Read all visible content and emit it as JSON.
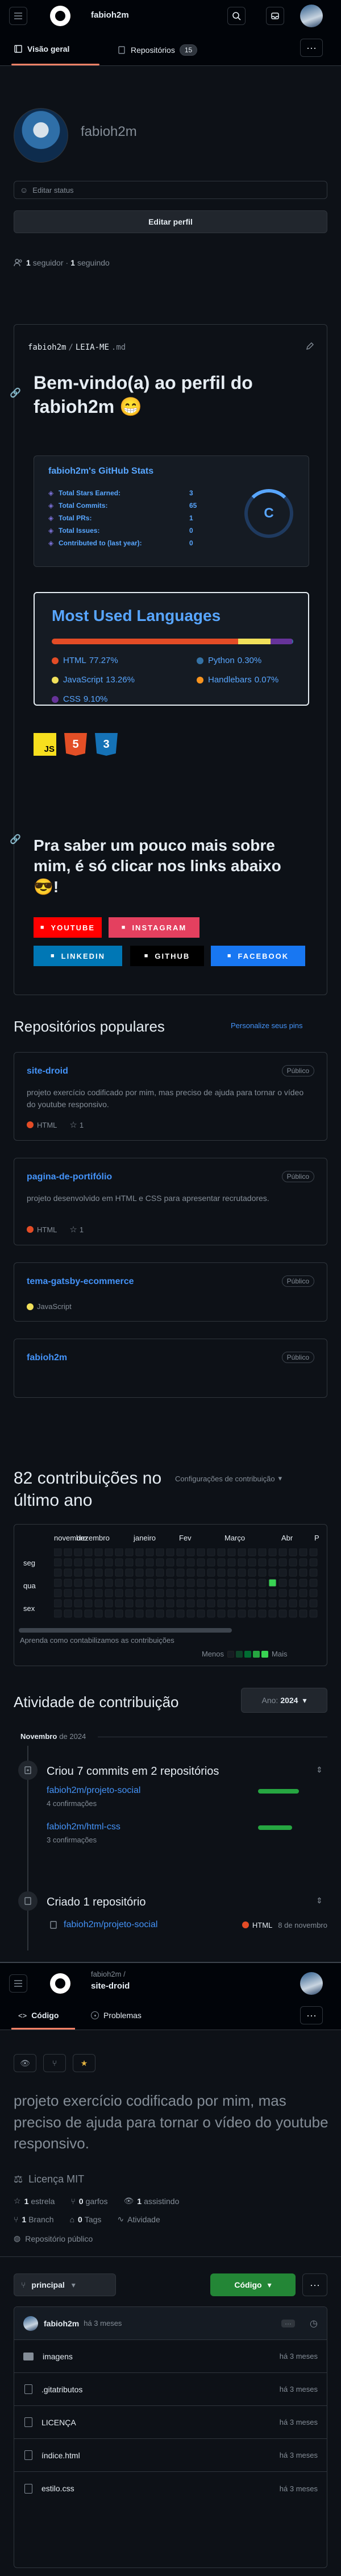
{
  "profile": {
    "header_user": "fabioh2m",
    "tabs": [
      {
        "label": "Visão geral"
      },
      {
        "label": "Repositórios",
        "count": "15"
      }
    ],
    "username": "fabioh2m",
    "status_placeholder": "Editar status",
    "edit_profile": "Editar perfil",
    "followers_count": "1",
    "followers_label": "seguidor",
    "following_count": "1",
    "following_label": "seguindo"
  },
  "readme": {
    "path_user": "fabioh2m",
    "path_sep": "/",
    "path_file": "LEIA-ME",
    "path_ext": ".md",
    "heading": "Bem-vindo(a) ao perfil do fabioh2m 😁",
    "stats": {
      "title": "fabioh2m's GitHub Stats",
      "rows": [
        {
          "label": "Total Stars Earned:",
          "value": "3"
        },
        {
          "label": "Total Commits:",
          "value": "65"
        },
        {
          "label": "Total PRs:",
          "value": "1"
        },
        {
          "label": "Total Issues:",
          "value": "0"
        },
        {
          "label": "Contributed to (last year):",
          "value": "0"
        }
      ],
      "grade": "C"
    },
    "langs": {
      "title": "Most Used Languages",
      "items": [
        {
          "name": "HTML",
          "pct": "77.27%",
          "value": 77.27,
          "color": "#e34c26"
        },
        {
          "name": "Python",
          "pct": "0.30%",
          "value": 0.3,
          "color": "#3572A5"
        },
        {
          "name": "JavaScript",
          "pct": "13.26%",
          "value": 13.26,
          "color": "#f1e05a"
        },
        {
          "name": "Handlebars",
          "pct": "0.07%",
          "value": 0.07,
          "color": "#f7931e"
        },
        {
          "name": "CSS",
          "pct": "9.10%",
          "value": 9.1,
          "color": "#663399"
        }
      ]
    },
    "tech_icons": [
      "JS",
      "5",
      "3"
    ],
    "links_heading": "Pra saber um pouco mais sobre mim, é só clicar nos links abaixo 😎!",
    "social": [
      {
        "label": "YOUTUBE",
        "color": "#ff0000"
      },
      {
        "label": "INSTAGRAM",
        "color": "#e4405f"
      },
      {
        "label": "LINKEDIN",
        "color": "#0077b5"
      },
      {
        "label": "GITHUB",
        "color": "#000000"
      },
      {
        "label": "FACEBOOK",
        "color": "#1877f2"
      }
    ]
  },
  "popular": {
    "title": "Repositórios populares",
    "customize": "Personalize seus pins",
    "repos": [
      {
        "name": "site-droid",
        "visibility": "Público",
        "desc": "projeto exercício codificado por mim, mas preciso de ajuda para tornar o vídeo do youtube responsivo.",
        "lang": "HTML",
        "lang_color": "#e34c26",
        "stars": "1"
      },
      {
        "name": "pagina-de-portifólio",
        "visibility": "Público",
        "desc": "projeto desenvolvido em HTML e CSS para apresentar recrutadores.",
        "lang": "HTML",
        "lang_color": "#e34c26",
        "stars": "1"
      },
      {
        "name": "tema-gatsby-ecommerce",
        "visibility": "Público",
        "desc": "",
        "lang": "JavaScript",
        "lang_color": "#f1e05a",
        "stars": ""
      },
      {
        "name": "fabioh2m",
        "visibility": "Público",
        "desc": "",
        "lang": "",
        "lang_color": "",
        "stars": ""
      }
    ]
  },
  "contrib": {
    "title": "82 contribuições no último ano",
    "settings": "Configurações de contribuição",
    "months": [
      "novembro",
      "dezembro",
      "janeiro",
      "Fev",
      "Março",
      "Abr",
      "P"
    ],
    "days": [
      "seg",
      "qua",
      "sex"
    ],
    "learn": "Aprenda como contabilizamos as contribuições",
    "less": "Menos",
    "more": "Mais"
  },
  "activity": {
    "title": "Atividade de contribuição",
    "year_label": "Ano:",
    "year": "2024",
    "month_name": "Novembro",
    "month_year": "de 2024",
    "commits_title": "Criou 7 commits em 2 repositórios",
    "commit_repos": [
      {
        "name": "fabioh2m/projeto-social",
        "count": "4 confirmações"
      },
      {
        "name": "fabioh2m/html-css",
        "count": "3 confirmações"
      }
    ],
    "created_title": "Criado 1 repositório",
    "created_repo": "fabioh2m/projeto-social",
    "created_lang": "HTML",
    "created_date": "8 de novembro"
  },
  "repo_page": {
    "owner": "fabioh2m /",
    "repo": "site-droid",
    "tab_code": "Código",
    "tab_problems": "Problemas",
    "description": "projeto exercício codificado por mim, mas preciso de ajuda para tornar o vídeo do youtube responsivo.",
    "license": "Licença MIT",
    "stars": "1",
    "stars_label": "estrela",
    "forks": "0",
    "forks_label": "garfos",
    "watching": "1",
    "watching_label": "assistindo",
    "branches": "1",
    "branches_label": "Branch",
    "tags": "0",
    "tags_label": "Tags",
    "activity": "Atividade",
    "public_repo": "Repositório público",
    "branch": "principal",
    "code_button": "Código",
    "commit_user": "fabioh2m",
    "commit_time": "há 3 meses",
    "files": [
      {
        "name": "imagens",
        "type": "folder",
        "time": "há 3 meses"
      },
      {
        "name": ".gitatributos",
        "type": "file",
        "time": "há 3 meses"
      },
      {
        "name": "LICENÇA",
        "type": "file",
        "time": "há 3 meses"
      },
      {
        "name": "índice.html",
        "type": "file",
        "time": "há 3 meses"
      },
      {
        "name": "estilo.css",
        "type": "file",
        "time": "há 3 meses"
      }
    ]
  }
}
